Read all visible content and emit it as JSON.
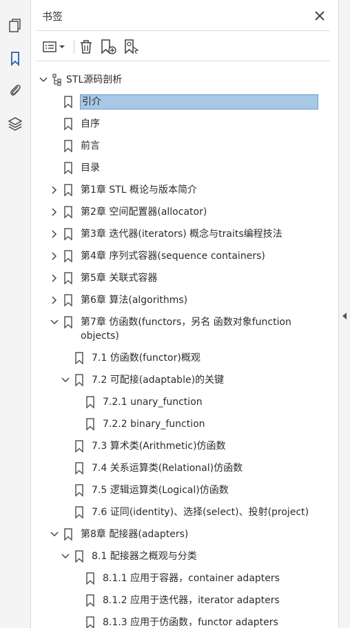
{
  "panel": {
    "title": "书签"
  },
  "rail": {
    "icons": [
      "pages-icon",
      "bookmark-icon",
      "attachment-icon",
      "layers-icon"
    ]
  },
  "toolbar": {
    "icons": [
      "options-icon",
      "delete-icon",
      "new-bookmark-icon",
      "new-bookmark-from-structure-icon"
    ]
  },
  "bookmarks": [
    {
      "label": "STL源码剖析",
      "level": 0,
      "expander": "open",
      "icon": "doc-tree"
    },
    {
      "label": "引介",
      "level": 1,
      "expander": "none",
      "selected": true
    },
    {
      "label": "自序",
      "level": 1,
      "expander": "none"
    },
    {
      "label": "前言",
      "level": 1,
      "expander": "none"
    },
    {
      "label": "目录",
      "level": 1,
      "expander": "none"
    },
    {
      "label": "第1章 STL 概论与版本简介",
      "level": 1,
      "expander": "closed"
    },
    {
      "label": "第2章 空间配置器(allocator)",
      "level": 1,
      "expander": "closed"
    },
    {
      "label": "第3章 迭代器(iterators) 概念与traits编程技法",
      "level": 1,
      "expander": "closed"
    },
    {
      "label": "第4章 序列式容器(sequence containers)",
      "level": 1,
      "expander": "closed"
    },
    {
      "label": "第5章 关联式容器",
      "level": 1,
      "expander": "closed"
    },
    {
      "label": "第6章 算法(algorithms)",
      "level": 1,
      "expander": "closed"
    },
    {
      "label": "第7章 仿函数(functors，另名 函数对象function objects)",
      "level": 1,
      "expander": "open",
      "wrap": true
    },
    {
      "label": "7.1 仿函数(functor)概观",
      "level": 2,
      "expander": "none"
    },
    {
      "label": "7.2 可配接(adaptable)的关键",
      "level": 2,
      "expander": "open"
    },
    {
      "label": "7.2.1 unary_function",
      "level": 3,
      "expander": "none"
    },
    {
      "label": "7.2.2 binary_function",
      "level": 3,
      "expander": "none"
    },
    {
      "label": "7.3 算术类(Arithmetic)仿函数",
      "level": 2,
      "expander": "none"
    },
    {
      "label": "7.4 关系运算类(Relational)仿函数",
      "level": 2,
      "expander": "none"
    },
    {
      "label": "7.5 逻辑运算类(Logical)仿函数",
      "level": 2,
      "expander": "none"
    },
    {
      "label": "7.6 证同(identity)、选择(select)、投射(project)",
      "level": 2,
      "expander": "none"
    },
    {
      "label": "第8章 配接器(adapters)",
      "level": 1,
      "expander": "open"
    },
    {
      "label": "8.1 配接器之概观与分类",
      "level": 2,
      "expander": "open"
    },
    {
      "label": "8.1.1 应用于容器，container adapters",
      "level": 3,
      "expander": "none"
    },
    {
      "label": "8.1.2 应用于迭代器，iterator adapters",
      "level": 3,
      "expander": "none"
    },
    {
      "label": "8.1.3 应用于仿函数，functor adapters",
      "level": 3,
      "expander": "none"
    }
  ],
  "colors": {
    "accent": "#1a62b8",
    "selection": "#a7c8e6",
    "icon": "#555555"
  }
}
